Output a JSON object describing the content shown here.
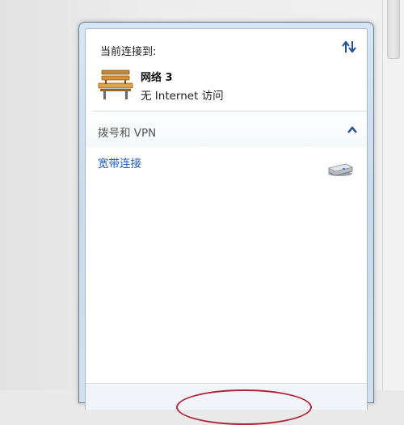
{
  "panel": {
    "current_connected_label": "当前连接到:",
    "network_name": "网络  3",
    "network_status": "无 Internet 访问"
  },
  "dialup_section": {
    "title": "拨号和 VPN",
    "connections": [
      {
        "label": "宽带连接"
      }
    ]
  },
  "icons": {
    "refresh": "refresh-icon",
    "network_type": "park-bench-icon",
    "collapse": "chevron-up-icon",
    "connection": "modem-icon"
  },
  "colors": {
    "link": "#1c59c4",
    "accent_arrow": "#1d4f9a",
    "annotation": "#b0243a"
  }
}
